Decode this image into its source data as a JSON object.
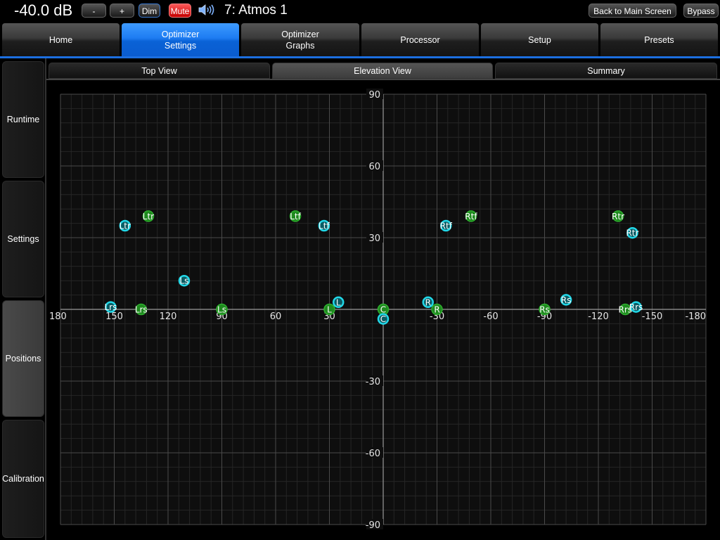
{
  "header": {
    "volume": "-40.0 dB",
    "vol_down_label": "-",
    "vol_up_label": "+",
    "dim_label": "Dim",
    "mute_label": "Mute",
    "preset_name": "7: Atmos 1",
    "back_label": "Back to Main Screen",
    "bypass_label": "Bypass",
    "speaker_icon": "speaker-volume-icon"
  },
  "main_tabs": [
    {
      "label": "Home",
      "active": false
    },
    {
      "label": "Optimizer\nSettings",
      "active": true
    },
    {
      "label": "Optimizer\nGraphs",
      "active": false
    },
    {
      "label": "Processor",
      "active": false
    },
    {
      "label": "Setup",
      "active": false
    },
    {
      "label": "Presets",
      "active": false
    }
  ],
  "side_tabs": [
    {
      "label": "Runtime",
      "active": false
    },
    {
      "label": "Settings",
      "active": false
    },
    {
      "label": "Positions",
      "active": true
    },
    {
      "label": "Calibration",
      "active": false
    }
  ],
  "sub_tabs": [
    {
      "label": "Top View",
      "active": false
    },
    {
      "label": "Elevation View",
      "active": true
    },
    {
      "label": "Summary",
      "active": false
    }
  ],
  "colors": {
    "accent": "#1d7cf2",
    "green_marker": "#1f8a1f",
    "cyan_marker": "#22d8e8",
    "mute_red": "#e02020"
  },
  "chart_data": {
    "type": "scatter",
    "xlim": [
      180,
      -180
    ],
    "ylim": [
      -90,
      90
    ],
    "x_ticks": [
      "180",
      "150",
      "120",
      "90",
      "60",
      "30",
      "0",
      "-30",
      "-60",
      "-90",
      "-120",
      "-150",
      "-180"
    ],
    "y_ticks": [
      "90",
      "60",
      "30",
      "-30",
      "-60",
      "-90"
    ],
    "grid": true,
    "series": [
      {
        "points": [
          {
            "label": "Ltr",
            "x": 131,
            "y": 39
          },
          {
            "label": "Ltf",
            "x": 49,
            "y": 39
          },
          {
            "label": "Rtf",
            "x": -49,
            "y": 39
          },
          {
            "label": "Rtr",
            "x": -131,
            "y": 39
          },
          {
            "label": "Lrs",
            "x": 135,
            "y": 0
          },
          {
            "label": "Ls",
            "x": 90,
            "y": 0
          },
          {
            "label": "L",
            "x": 30,
            "y": 0
          },
          {
            "label": "C",
            "x": 0,
            "y": 0
          },
          {
            "label": "R",
            "x": -30,
            "y": 0
          },
          {
            "label": "Rs",
            "x": -90,
            "y": 0
          },
          {
            "label": "Rrs",
            "x": -135,
            "y": 0
          }
        ]
      },
      {
        "points": [
          {
            "label": "Ltr",
            "x": 144,
            "y": 35
          },
          {
            "label": "Ltf",
            "x": 33,
            "y": 35
          },
          {
            "label": "Rtf",
            "x": -35,
            "y": 35
          },
          {
            "label": "Rtr",
            "x": -139,
            "y": 32
          },
          {
            "label": "Ls",
            "x": 111,
            "y": 12
          },
          {
            "label": "Lrs",
            "x": 152,
            "y": 1
          },
          {
            "label": "L",
            "x": 25,
            "y": 3
          },
          {
            "label": "C",
            "x": 0,
            "y": -4
          },
          {
            "label": "R",
            "x": -25,
            "y": 3
          },
          {
            "label": "Rs",
            "x": -102,
            "y": 4
          },
          {
            "label": "Rrs",
            "x": -141,
            "y": 1
          }
        ]
      }
    ]
  }
}
